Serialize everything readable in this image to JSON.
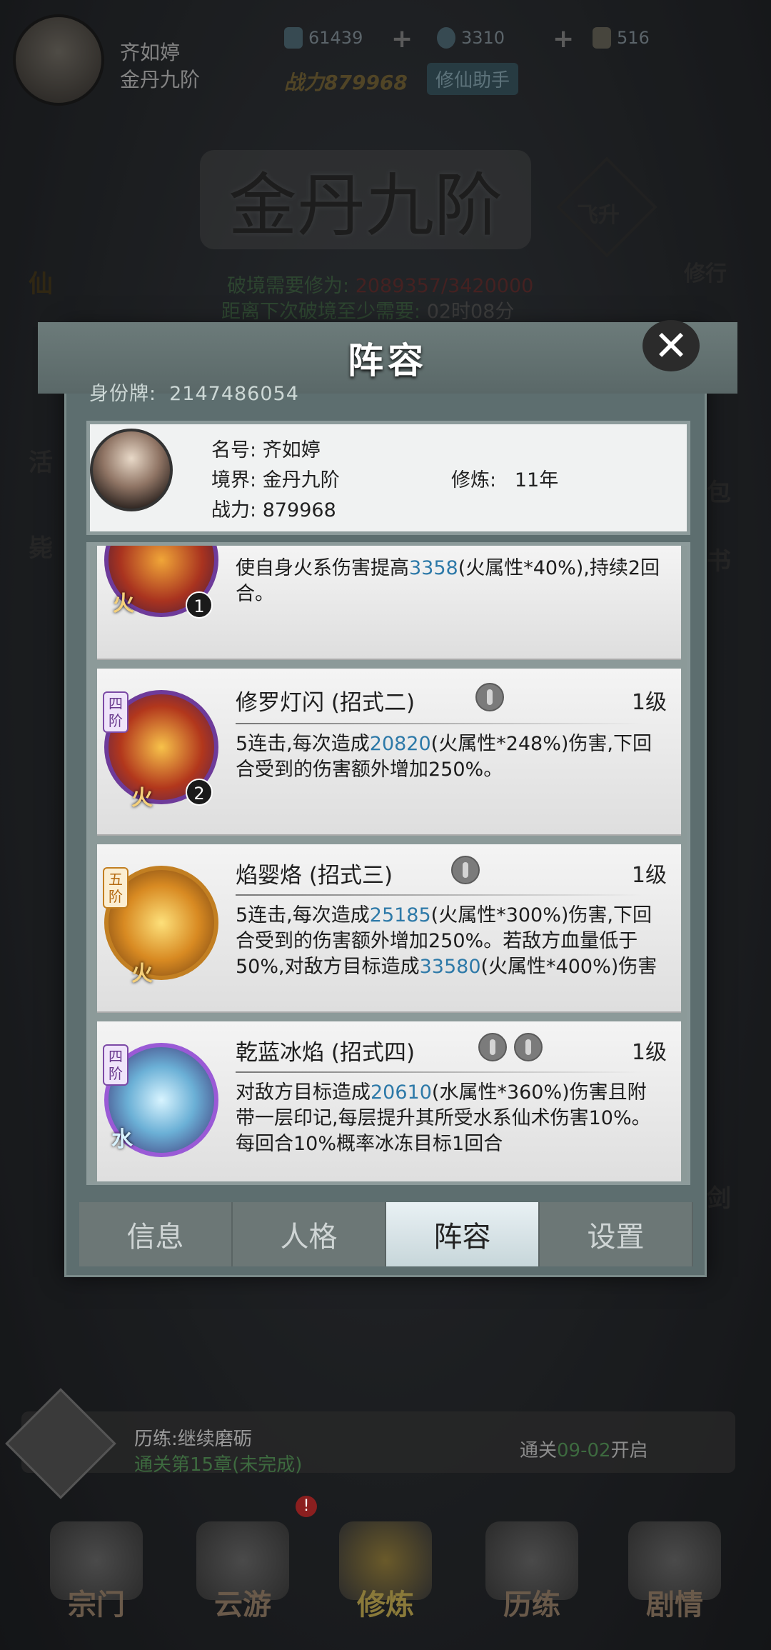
{
  "top": {
    "player_name": "齐如婷",
    "realm": "金丹九阶",
    "resources": [
      {
        "icon": "spirit-stone-icon",
        "value": "61439"
      },
      {
        "icon": "ring-icon",
        "value": "3310"
      },
      {
        "icon": "scroll-icon",
        "value": "516"
      }
    ],
    "power_label": "战力879968",
    "helper_label": "修仙助手",
    "big_title": "金丹九阶",
    "breakthrough_label": "破境需要修为:",
    "breakthrough_value": "2089357/3420000",
    "next_label": "距离下次破境至少需要:",
    "next_value": "02时08分",
    "side_left": [
      "仙",
      "活",
      "毙"
    ],
    "side_right": [
      "修行",
      "包",
      "书",
      "剑"
    ],
    "ascend": "飞升"
  },
  "panel": {
    "title": "阵容",
    "close_icon": "close-icon",
    "id_label": "身份牌:",
    "id_value": "2147486054",
    "info": {
      "name_label": "名号:",
      "name_value": "齐如婷",
      "realm_label": "境界:",
      "realm_value": "金丹九阶",
      "cultivate_label": "修炼:",
      "cultivate_value": "11年",
      "power_label": "战力:",
      "power_value": "879968"
    },
    "skills": [
      {
        "elem": "火",
        "badge": "1",
        "desc_pre": "使自身火系伤害提高",
        "desc_num1": "3358",
        "desc_mid": "(火属性*40%),持续2回合。"
      },
      {
        "tier": "四阶",
        "elem": "火",
        "badge": "2",
        "name": "修罗灯闪 (招式二)",
        "level": "1级",
        "desc_pre": "5连击,每次造成",
        "desc_num1": "20820",
        "desc_mid": "(火属性*248%)伤害,下回合受到的伤害额外增加250%。"
      },
      {
        "tier": "五阶",
        "elem": "火",
        "name": "焰婴烙 (招式三)",
        "level": "1级",
        "desc_pre": "5连击,每次造成",
        "desc_num1": "25185",
        "desc_mid": "(火属性*300%)伤害,下回合受到的伤害额外增加250%。若敌方血量低于50%,对敌方目标造成",
        "desc_num2": "33580",
        "desc_post": "(火属性*400%)伤害"
      },
      {
        "tier": "四阶",
        "elem": "水",
        "name": "乾蓝冰焰 (招式四)",
        "level": "1级",
        "desc_pre": "对敌方目标造成",
        "desc_num1": "20610",
        "desc_mid": "(水属性*360%)伤害且附带一层印记,每层提升其所受水系仙术伤害10%。每回合10%概率冰冻目标1回合"
      }
    ],
    "tabs": [
      "信息",
      "人格",
      "阵容",
      "设置"
    ]
  },
  "bottom": {
    "mission_label": "历练:继续磨砺",
    "mission_progress": "通关第15章(未完成)",
    "unlock_prefix": "通关",
    "unlock_stage": "09-02",
    "unlock_suffix": "开启",
    "nav": [
      "宗门",
      "云游",
      "修炼",
      "历练",
      "剧情"
    ],
    "notice_badge": "!"
  }
}
